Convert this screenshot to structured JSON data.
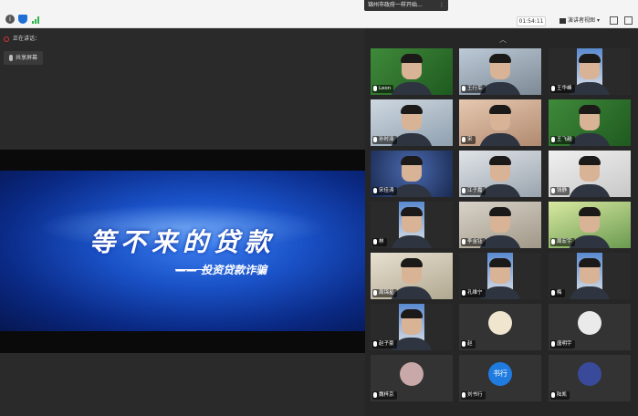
{
  "topbar": {
    "banner_text": "锦州市政府一样开始...",
    "banner_menu": "⋮",
    "timer": "01:54:11",
    "view_label": "演讲者视图",
    "view_arrow": "▾"
  },
  "left": {
    "presenter_name": "正在讲话：",
    "mic_chip_label": "共享屏幕"
  },
  "share": {
    "title": "等不来的贷款",
    "subtitle": "投资贷款诈骗"
  },
  "right": {
    "collapse_icon": "︿",
    "participants": [
      {
        "name": "Leon"
      },
      {
        "name": "王行军"
      },
      {
        "name": "王华峰"
      },
      {
        "name": "孙时泽"
      },
      {
        "name": "宋"
      },
      {
        "name": "王飞越"
      },
      {
        "name": "宋佳涛"
      },
      {
        "name": "江子嘉"
      },
      {
        "name": "钱静"
      },
      {
        "name": "林"
      },
      {
        "name": "李金钰"
      },
      {
        "name": "周宏宇"
      },
      {
        "name": "周锦星"
      },
      {
        "name": "孔维宁"
      },
      {
        "name": "梅"
      },
      {
        "name": "赵子豪"
      },
      {
        "name": "赵"
      },
      {
        "name": "唐明宇"
      },
      {
        "name": "魏梓京"
      },
      {
        "name": "刘书行"
      },
      {
        "name": "陆凯"
      }
    ],
    "avatar_text": "书行"
  },
  "colors": {
    "slide_blue": "#1a52c8",
    "panel_bg": "#262626",
    "topbar_bg": "#f4f4f4"
  }
}
